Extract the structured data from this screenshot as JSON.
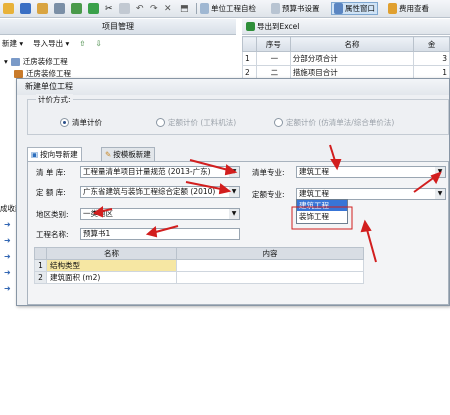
{
  "toolbar": {
    "self_check_label": "单位工程自检",
    "budget_settings_label": "预算书设置",
    "property_window_label": "属性窗口",
    "fee_view_label": "费用查看"
  },
  "left_panel": {
    "header": "项目管理",
    "new_label": "新建",
    "import_export_label": "导入导出",
    "tree": [
      {
        "label": "迁房装修工程"
      },
      {
        "label": "迁房装修工程"
      }
    ],
    "side_snippet": "成收藏"
  },
  "right_panel": {
    "export_label": "导出到Excel",
    "columns": [
      "",
      "序号",
      "名称",
      "金"
    ],
    "rows": [
      {
        "idx": "1",
        "seq": "一",
        "name": "分部分项合计",
        "amount": "3"
      },
      {
        "idx": "2",
        "seq": "二",
        "name": "措施项目合计",
        "amount": "1"
      }
    ]
  },
  "dialog": {
    "title": "新建单位工程",
    "calc_method_label": "计价方式:",
    "radios": [
      {
        "label": "清单计价",
        "selected": true,
        "enabled": true
      },
      {
        "label": "定额计价 (工料机法)",
        "selected": false,
        "enabled": false
      },
      {
        "label": "定额计价 (仿清单法/综合单价法)",
        "selected": false,
        "enabled": false
      }
    ],
    "tabs": [
      {
        "label": "按向导新建",
        "selected": true
      },
      {
        "label": "按模板新建",
        "selected": false
      }
    ],
    "fields": {
      "list_lib_label": "清 单 库:",
      "list_lib_value": "工程量清单项目计量规范 (2013-广东)",
      "quota_lib_label": "定 额 库:",
      "quota_lib_value": "广东省建筑与装饰工程综合定额 (2010)",
      "region_label": "地区类别:",
      "region_value": "一类地区",
      "project_name_label": "工程名称:",
      "project_name_value": "预算书1",
      "list_major_label": "清单专业:",
      "list_major_value": "建筑工程",
      "quota_major_label": "定额专业:",
      "quota_major_value": "建筑工程"
    },
    "dropdown_options": [
      "建筑工程",
      "装饰工程"
    ],
    "inner_table": {
      "columns": [
        "",
        "名称",
        "内容"
      ],
      "rows": [
        {
          "idx": "1",
          "name": "结构类型",
          "content": ""
        },
        {
          "idx": "2",
          "name": "建筑面积 (m2)",
          "content": ""
        }
      ]
    }
  },
  "colors": {
    "accent": "#3875d7",
    "annotation_red": "#d21e1e",
    "selected_cell": "#f6e7a3"
  }
}
